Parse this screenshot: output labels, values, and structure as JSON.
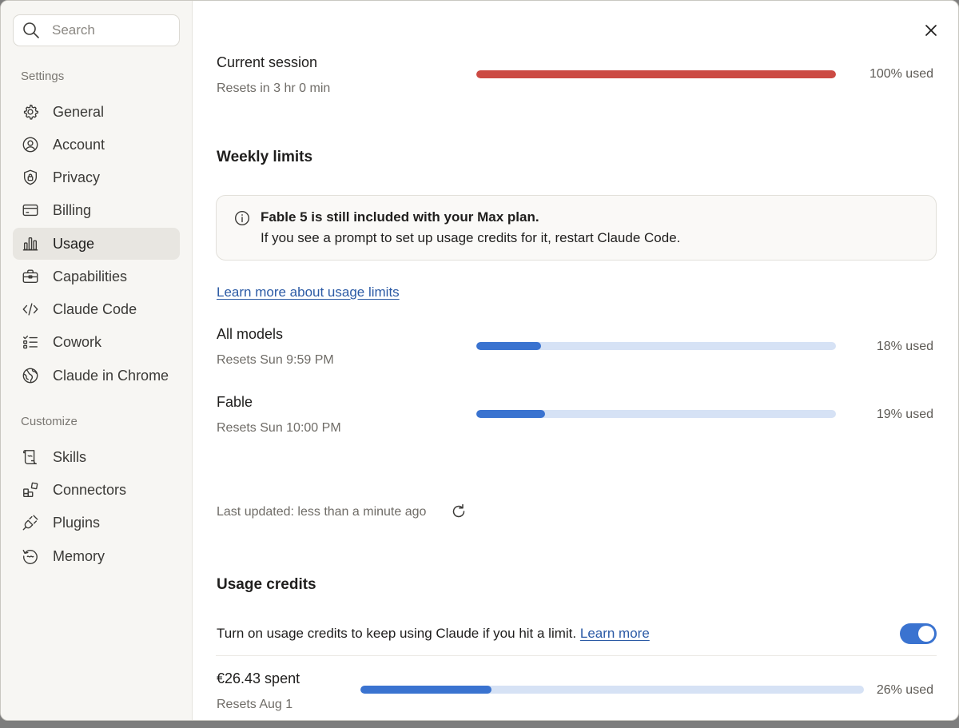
{
  "colors": {
    "accent": "#3a73d0",
    "track": "#d6e2f5",
    "danger": "#cc4a43",
    "sidebar_bg": "#f7f6f3",
    "active_bg": "#e8e6e1"
  },
  "search": {
    "placeholder": "Search",
    "icon": "search-icon"
  },
  "sidebar": {
    "settings_label": "Settings",
    "settings_items": [
      {
        "label": "General",
        "icon": "gear-icon"
      },
      {
        "label": "Account",
        "icon": "user-circle-icon"
      },
      {
        "label": "Privacy",
        "icon": "shield-lock-icon"
      },
      {
        "label": "Billing",
        "icon": "credit-card-icon"
      },
      {
        "label": "Usage",
        "icon": "bar-chart-icon",
        "active": true
      },
      {
        "label": "Capabilities",
        "icon": "toolbox-icon"
      },
      {
        "label": "Claude Code",
        "icon": "code-brackets-icon"
      },
      {
        "label": "Cowork",
        "icon": "checklist-icon"
      },
      {
        "label": "Claude in Chrome",
        "icon": "globe-icon"
      }
    ],
    "customize_label": "Customize",
    "customize_items": [
      {
        "label": "Skills",
        "icon": "scroll-icon"
      },
      {
        "label": "Connectors",
        "icon": "blocks-icon"
      },
      {
        "label": "Plugins",
        "icon": "plug-icon"
      },
      {
        "label": "Memory",
        "icon": "history-icon"
      }
    ]
  },
  "current_session": {
    "title": "Current session",
    "reset": "Resets in 3 hr 0 min",
    "percent": 100,
    "used_label": "100% used"
  },
  "weekly": {
    "heading": "Weekly limits",
    "notice_title": "Fable 5 is still included with your Max plan.",
    "notice_body": "If you see a prompt to set up usage credits for it, restart Claude Code.",
    "learn_link": "Learn more about usage limits",
    "rows": [
      {
        "title": "All models",
        "reset": "Resets Sun 9:59 PM",
        "percent": 18,
        "used_label": "18% used"
      },
      {
        "title": "Fable",
        "reset": "Resets Sun 10:00 PM",
        "percent": 19,
        "used_label": "19% used"
      }
    ],
    "last_updated": "Last updated: less than a minute ago"
  },
  "credits": {
    "heading": "Usage credits",
    "description": "Turn on usage credits to keep using Claude if you hit a limit.",
    "learn_more": "Learn more",
    "toggle_on": true,
    "spent": "€26.43 spent",
    "reset": "Resets Aug 1",
    "percent": 26,
    "used_label": "26% used"
  }
}
